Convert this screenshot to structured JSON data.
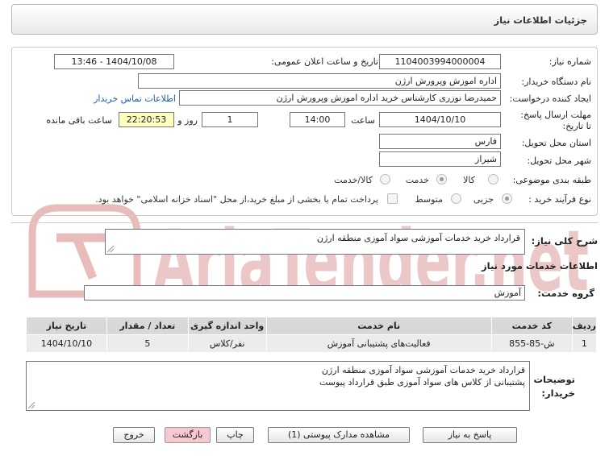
{
  "header": {
    "title": "جزئیات اطلاعات نیاز"
  },
  "form": {
    "need_number_label": "شماره نیاز:",
    "need_number": "1104003994000004",
    "announce_label": "تاریخ و ساعت اعلان عمومی:",
    "announce_value": "1404/10/08 - 13:46",
    "buyer_org_label": "نام دستگاه خریدار:",
    "buyer_org": "اداره اموزش وپرورش ارژن",
    "creator_label": "ایجاد کننده درخواست:",
    "creator": "حمیدرضا نوزری کارشناس خرید اداره اموزش وپرورش ارژن",
    "contact_link": "اطلاعات تماس خریدار",
    "deadline_label": "مهلت ارسال پاسخ: تا تاریخ:",
    "deadline_date": "1404/10/10",
    "time_label": "ساعت",
    "deadline_time": "14:00",
    "days_value": "1",
    "days_label": "روز و",
    "remaining_value": "22:20:53",
    "remaining_label": "ساعت باقی مانده",
    "province_label": "استان محل تحویل:",
    "province": "فارس",
    "city_label": "شهر محل تحویل:",
    "city": "شیراز",
    "category_label": "طبقه بندی موضوعی:",
    "category_options": [
      "کالا",
      "خدمت",
      "کالا/خدمت"
    ],
    "category_selected": "خدمت",
    "process_label": "نوع فرآیند خرید :",
    "process_options": [
      "جزیی",
      "متوسط"
    ],
    "process_selected": "جزیی",
    "payment_note": "پرداخت تمام یا بخشی از مبلغ خرید،از محل \"اسناد خزانه اسلامی\" خواهد بود."
  },
  "description": {
    "label": "شرح کلی نیاز:",
    "value": "قرارداد خرید خدمات آموزشی سواد آموزی منطقه ارژن"
  },
  "services": {
    "section_title": "اطلاعات خدمات مورد نیاز",
    "group_label": "گروه خدمت:",
    "group_value": "آموزش",
    "columns": [
      "ردیف",
      "کد خدمت",
      "نام خدمت",
      "واحد اندازه گیری",
      "تعداد / مقدار",
      "تاریخ نیاز"
    ],
    "rows": [
      {
        "row": "1",
        "code": "ش-85-855",
        "name": "فعالیت‌های پشتیبانی آموزش",
        "unit": "نفر/کلاس",
        "qty": "5",
        "date": "1404/10/10"
      }
    ]
  },
  "buyer_notes": {
    "label_line1": "توضیحات",
    "label_line2": "خریدار:",
    "line1": "قرارداد خرید خدمات آموزشی سواد آموزی منطقه ارژن",
    "line2": "پشتیبانی از کلاس های سواد آموزی طبق قرارداد پیوست"
  },
  "buttons": {
    "reply": "پاسخ به نیاز",
    "attachments": "مشاهده مدارک پیوستی (1)",
    "print": "چاپ",
    "back": "بازگشت",
    "exit": "خروج"
  },
  "watermark": {
    "text": "AriaTender.net"
  },
  "colors": {
    "link": "#1a5fb4",
    "remaining_bg": "#ffffc0",
    "pink_button": "#f7c8cf",
    "watermark": "#e8b9b9"
  }
}
